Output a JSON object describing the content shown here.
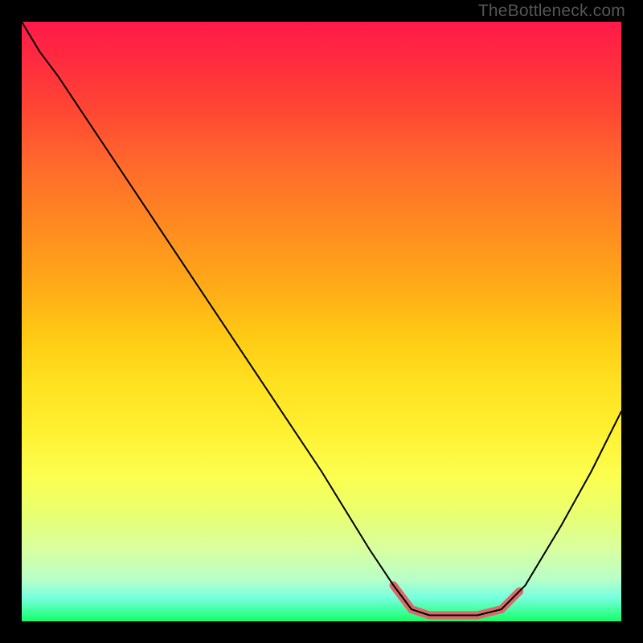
{
  "watermark": "TheBottleneck.com",
  "chart_data": {
    "type": "line",
    "title": "",
    "xlabel": "",
    "ylabel": "",
    "xlim": [
      0,
      100
    ],
    "ylim": [
      0,
      100
    ],
    "grid": false,
    "legend": false,
    "gradient_stops": [
      {
        "pos": 0,
        "color": "#ff1a4a"
      },
      {
        "pos": 6,
        "color": "#ff2a40"
      },
      {
        "pos": 14,
        "color": "#ff4434"
      },
      {
        "pos": 24,
        "color": "#ff6a2c"
      },
      {
        "pos": 34,
        "color": "#ff8a20"
      },
      {
        "pos": 44,
        "color": "#ffaa18"
      },
      {
        "pos": 52,
        "color": "#ffc814"
      },
      {
        "pos": 60,
        "color": "#ffe020"
      },
      {
        "pos": 68,
        "color": "#fff030"
      },
      {
        "pos": 76,
        "color": "#fbff50"
      },
      {
        "pos": 82,
        "color": "#eaff70"
      },
      {
        "pos": 88,
        "color": "#d8ffa0"
      },
      {
        "pos": 93,
        "color": "#b8ffc8"
      },
      {
        "pos": 96,
        "color": "#78ffe0"
      },
      {
        "pos": 100,
        "color": "#14ff6a"
      }
    ],
    "series": [
      {
        "name": "curve",
        "color": "#000000",
        "stroke_width": 2,
        "points": [
          {
            "x": 0,
            "y": 100
          },
          {
            "x": 3,
            "y": 95
          },
          {
            "x": 6,
            "y": 91
          },
          {
            "x": 10,
            "y": 85
          },
          {
            "x": 20,
            "y": 70
          },
          {
            "x": 30,
            "y": 55
          },
          {
            "x": 40,
            "y": 40
          },
          {
            "x": 50,
            "y": 25
          },
          {
            "x": 58,
            "y": 12
          },
          {
            "x": 62,
            "y": 6
          },
          {
            "x": 65,
            "y": 2
          },
          {
            "x": 68,
            "y": 1
          },
          {
            "x": 72,
            "y": 1
          },
          {
            "x": 76,
            "y": 1
          },
          {
            "x": 80,
            "y": 2
          },
          {
            "x": 84,
            "y": 6
          },
          {
            "x": 90,
            "y": 16
          },
          {
            "x": 95,
            "y": 25
          },
          {
            "x": 100,
            "y": 35
          }
        ]
      },
      {
        "name": "highlight",
        "color": "#d96a6a",
        "stroke_width": 10,
        "points": [
          {
            "x": 62,
            "y": 6
          },
          {
            "x": 65,
            "y": 2
          },
          {
            "x": 68,
            "y": 1
          },
          {
            "x": 72,
            "y": 1
          },
          {
            "x": 76,
            "y": 1
          },
          {
            "x": 80,
            "y": 2
          },
          {
            "x": 83,
            "y": 5
          }
        ]
      }
    ]
  }
}
